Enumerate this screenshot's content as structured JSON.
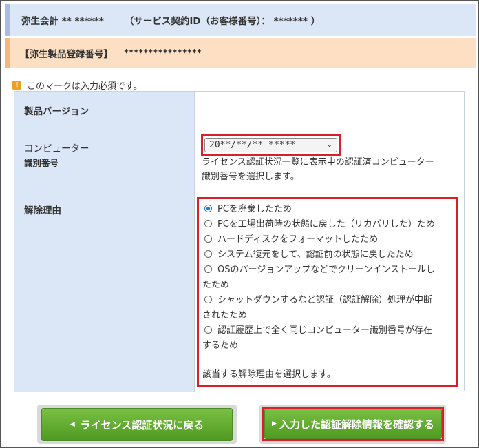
{
  "header": {
    "product_line": "弥生会計 ** ******",
    "contract_id": "（サービス契約ID（お客様番号）： ******* ）",
    "registration_label": "【弥生製品登録番号】",
    "registration_value": "****************"
  },
  "notice": {
    "icon_text": "!",
    "text": "このマークは入力必須です。"
  },
  "form": {
    "version_label": "製品バージョン",
    "computer_label_line1": "コンピューター",
    "computer_label_line2": "識別番号",
    "computer_select_value": "20**/**/** *****",
    "computer_desc_line1": "ライセンス認証状況一覧に表示中の認証済コンピューター",
    "computer_desc_line2": "識別番号を選択します。",
    "reason_label": "解除理由",
    "reasons": [
      {
        "text": "PCを廃棄したため",
        "selected": true
      },
      {
        "text": "PCを工場出荷時の状態に戻した（リカバリした）ため",
        "selected": false
      },
      {
        "text": "ハードディスクをフォーマットしたため",
        "selected": false
      },
      {
        "text": "システム復元をして、認証前の状態に戻したため",
        "selected": false
      },
      {
        "text_line1": "OSのバージョンアップなどでクリーンインストールし",
        "text_line2": "たため",
        "selected": false
      },
      {
        "text_line1": "シャットダウンするなど認証（認証解除）処理が中断",
        "text_line2": "されたため",
        "selected": false
      },
      {
        "text_line1": "認証履歴上で全く同じコンピューター識別番号が存在",
        "text_line2": "するため",
        "selected": false
      }
    ],
    "reason_desc": "該当する解除理由を選択します。"
  },
  "buttons": {
    "back": "ライセンス認証状況に戻る",
    "confirm": "入力した認証解除情報を確認する"
  },
  "colors": {
    "header_blue": "#dbe6f6",
    "header_orange": "#fde0c4",
    "highlight_red": "#d81f2a",
    "button_green": "#5aa82a"
  }
}
